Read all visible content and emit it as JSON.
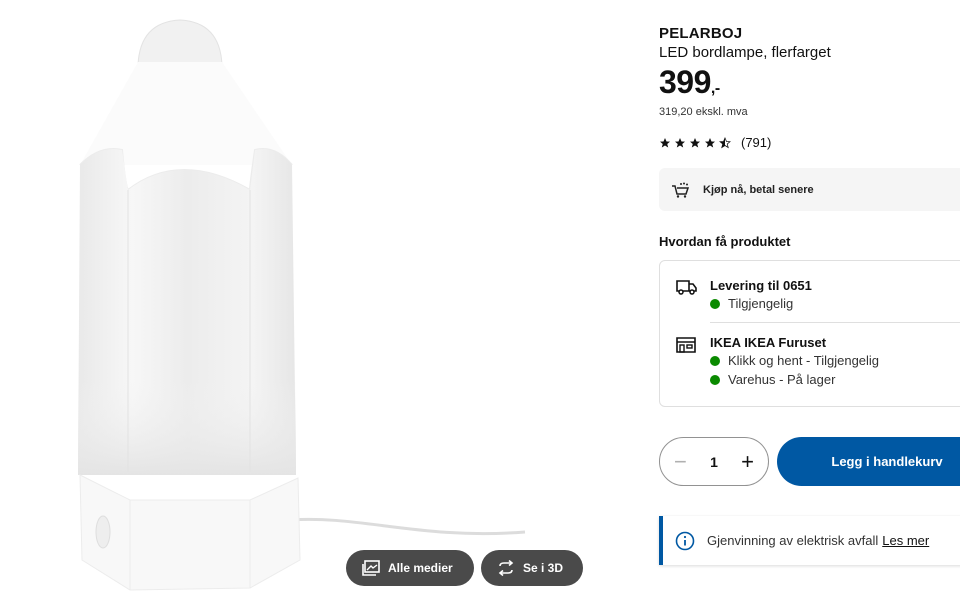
{
  "product": {
    "name": "PELARBOJ",
    "description": "LED bordlampe, flerfarget",
    "price": "399",
    "price_suffix": ",-",
    "price_ex_vat": "319,20 ekskl. mva",
    "rating": {
      "stars": 4.5,
      "max": 5,
      "count": "(791)"
    }
  },
  "media_buttons": {
    "all_media": "Alle medier",
    "view_3d": "Se i 3D"
  },
  "bnpl": {
    "label": "Kjøp nå, betal senere"
  },
  "availability": {
    "title": "Hvordan få produktet",
    "delivery": {
      "title": "Levering til 0651",
      "status": "Tilgjengelig"
    },
    "store": {
      "title": "IKEA IKEA Furuset",
      "click_collect": "Klikk og hent - Tilgjengelig",
      "warehouse": "Varehus - På lager"
    },
    "status_color": "#0a8a00"
  },
  "cart": {
    "quantity": "1",
    "minus": "−",
    "plus": "+",
    "add_label": "Legg i handlekurv"
  },
  "notice": {
    "text": "Gjenvinning av elektrisk avfall",
    "link": "Les mer"
  },
  "colors": {
    "accent": "#0058a3",
    "media_button_bg": "#4a4a4a",
    "panel_bg": "#f5f5f5"
  }
}
